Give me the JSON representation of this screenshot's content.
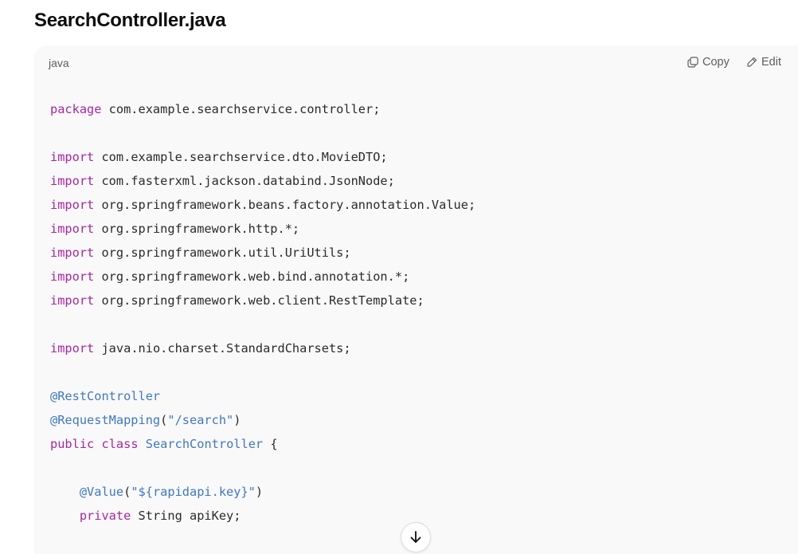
{
  "file_title": "SearchController.java",
  "code_block": {
    "language": "java",
    "copy_label": "Copy",
    "edit_label": "Edit",
    "lines": [
      [
        {
          "t": "package",
          "c": "kw"
        },
        {
          "t": " com.example.searchservice.controller;"
        }
      ],
      [],
      [
        {
          "t": "import",
          "c": "kw"
        },
        {
          "t": " com.example.searchservice.dto.MovieDTO;"
        }
      ],
      [
        {
          "t": "import",
          "c": "kw"
        },
        {
          "t": " com.fasterxml.jackson.databind.JsonNode;"
        }
      ],
      [
        {
          "t": "import",
          "c": "kw"
        },
        {
          "t": " org.springframework.beans.factory.annotation.Value;"
        }
      ],
      [
        {
          "t": "import",
          "c": "kw"
        },
        {
          "t": " org.springframework.http.*;"
        }
      ],
      [
        {
          "t": "import",
          "c": "kw"
        },
        {
          "t": " org.springframework.util.UriUtils;"
        }
      ],
      [
        {
          "t": "import",
          "c": "kw"
        },
        {
          "t": " org.springframework.web.bind.annotation.*;"
        }
      ],
      [
        {
          "t": "import",
          "c": "kw"
        },
        {
          "t": " org.springframework.web.client.RestTemplate;"
        }
      ],
      [],
      [
        {
          "t": "import",
          "c": "kw"
        },
        {
          "t": " java.nio.charset.StandardCharsets;"
        }
      ],
      [],
      [
        {
          "t": "@RestController",
          "c": "an"
        }
      ],
      [
        {
          "t": "@RequestMapping",
          "c": "an"
        },
        {
          "t": "("
        },
        {
          "t": "\"/search\"",
          "c": "st"
        },
        {
          "t": ")"
        }
      ],
      [
        {
          "t": "public",
          "c": "kw"
        },
        {
          "t": " "
        },
        {
          "t": "class",
          "c": "kw"
        },
        {
          "t": " "
        },
        {
          "t": "SearchController",
          "c": "cls"
        },
        {
          "t": " {"
        }
      ],
      [],
      [
        {
          "t": "    "
        },
        {
          "t": "@Value",
          "c": "an"
        },
        {
          "t": "("
        },
        {
          "t": "\"${rapidapi.key}\"",
          "c": "st"
        },
        {
          "t": ")"
        }
      ],
      [
        {
          "t": "    "
        },
        {
          "t": "private",
          "c": "kw"
        },
        {
          "t": " String apiKey;"
        }
      ]
    ]
  },
  "icons": {
    "copy": "copy-icon",
    "edit": "pencil-icon",
    "scroll": "arrow-down-icon"
  },
  "colors": {
    "keyword": "#a626a4",
    "annotation": "#4078c0",
    "string": "#4078c0",
    "class_name": "#4078c0",
    "code_bg": "#f9f9f9"
  }
}
